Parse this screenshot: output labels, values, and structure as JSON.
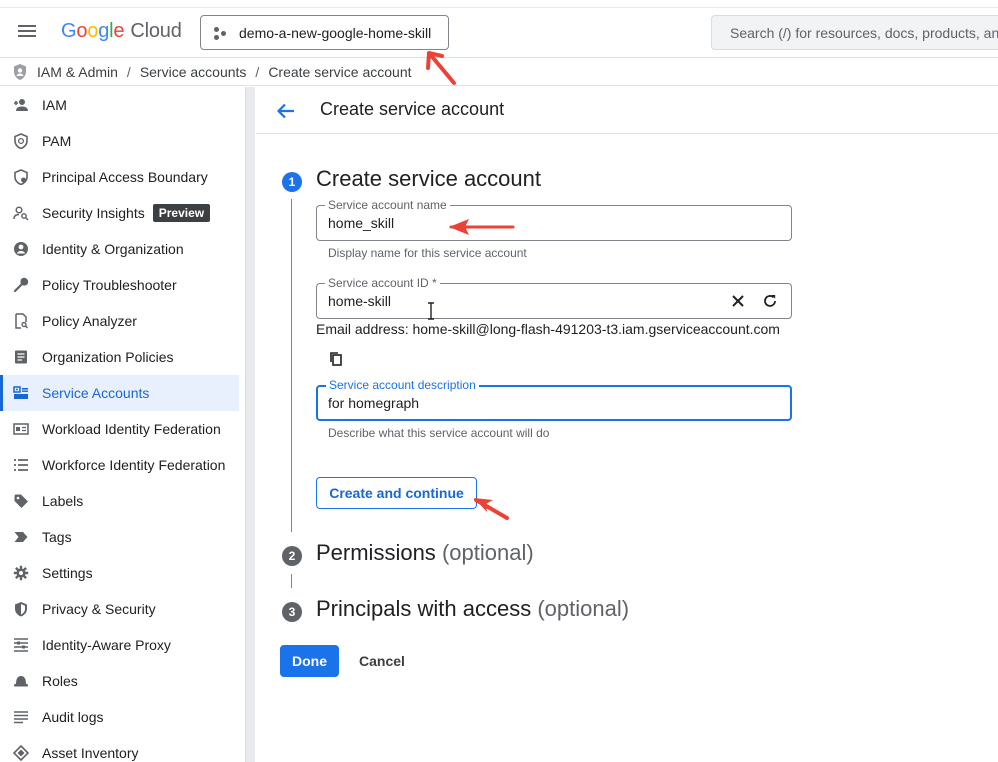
{
  "header": {
    "logo_parts": [
      "G",
      "o",
      "o",
      "g",
      "l",
      "e"
    ],
    "logo_product": "Cloud",
    "project_name": "demo-a-new-google-home-skill",
    "search_placeholder": "Search (/) for resources, docs, products, and more"
  },
  "breadcrumb": {
    "items": [
      "IAM & Admin",
      "Service accounts",
      "Create service account"
    ],
    "separator": "/"
  },
  "sidebar": {
    "items": [
      {
        "label": "IAM",
        "icon": "person-add-icon"
      },
      {
        "label": "PAM",
        "icon": "shield-clock-icon"
      },
      {
        "label": "Principal Access Boundary",
        "icon": "shield-gear-icon"
      },
      {
        "label": "Security Insights",
        "icon": "person-search-icon",
        "badge": "Preview"
      },
      {
        "label": "Identity & Organization",
        "icon": "account-circle-icon"
      },
      {
        "label": "Policy Troubleshooter",
        "icon": "wrench-icon"
      },
      {
        "label": "Policy Analyzer",
        "icon": "document-search-icon"
      },
      {
        "label": "Organization Policies",
        "icon": "list-document-icon"
      },
      {
        "label": "Service Accounts",
        "icon": "service-account-icon",
        "active": true
      },
      {
        "label": "Workload Identity Federation",
        "icon": "id-card-icon"
      },
      {
        "label": "Workforce Identity Federation",
        "icon": "list-icon"
      },
      {
        "label": "Labels",
        "icon": "tag-icon"
      },
      {
        "label": "Tags",
        "icon": "chevron-tag-icon"
      },
      {
        "label": "Settings",
        "icon": "gear-icon"
      },
      {
        "label": "Privacy & Security",
        "icon": "shield-icon"
      },
      {
        "label": "Identity-Aware Proxy",
        "icon": "grid-icon"
      },
      {
        "label": "Roles",
        "icon": "hat-icon"
      },
      {
        "label": "Audit logs",
        "icon": "lines-icon"
      },
      {
        "label": "Asset Inventory",
        "icon": "diamond-icon"
      }
    ]
  },
  "page": {
    "title": "Create service account",
    "steps": [
      {
        "number": "1",
        "title": "Create service account",
        "optional": ""
      },
      {
        "number": "2",
        "title": "Permissions",
        "optional": "(optional)"
      },
      {
        "number": "3",
        "title": "Principals with access",
        "optional": "(optional)"
      }
    ],
    "fields": {
      "name": {
        "label": "Service account name",
        "value": "home_skill",
        "helper": "Display name for this service account"
      },
      "id": {
        "label": "Service account ID *",
        "value": "home-skill"
      },
      "email": {
        "prefix": "Email address: ",
        "value": "home-skill@long-flash-491203-t3.iam.gserviceaccount.com"
      },
      "description": {
        "label": "Service account description",
        "value": "for homegraph",
        "helper": "Describe what this service account will do"
      }
    },
    "create_continue_label": "Create and continue",
    "done_label": "Done",
    "cancel_label": "Cancel"
  },
  "colors": {
    "accent": "#1a73e8",
    "active_bg": "#e8f0fe",
    "annotation": "#ea4335"
  }
}
